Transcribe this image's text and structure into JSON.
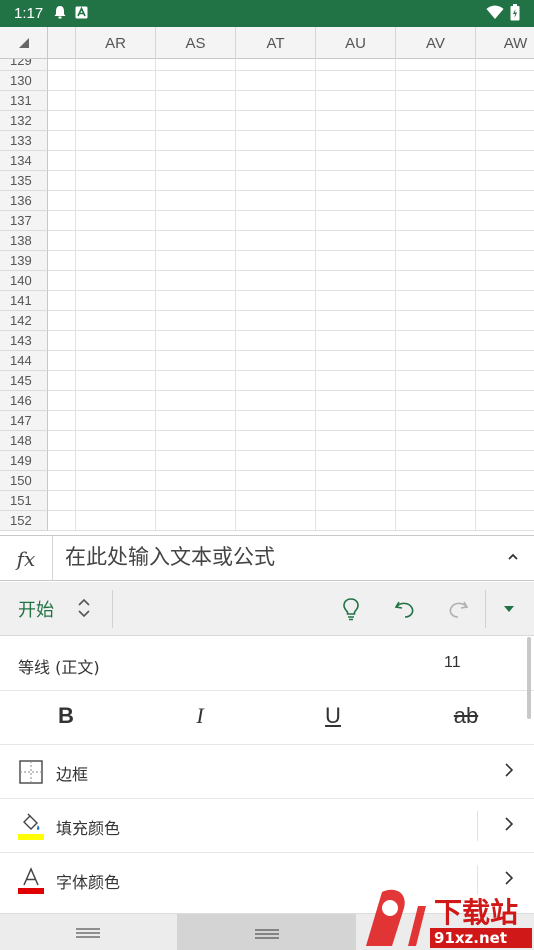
{
  "status_bar": {
    "time": "1:17"
  },
  "sheet": {
    "columns": [
      "AR",
      "AS",
      "AT",
      "AU",
      "AV",
      "AW"
    ],
    "rows": [
      "129",
      "130",
      "131",
      "132",
      "133",
      "134",
      "135",
      "136",
      "137",
      "138",
      "139",
      "140",
      "141",
      "142",
      "143",
      "144",
      "145",
      "146",
      "147",
      "148",
      "149",
      "150",
      "151",
      "152"
    ]
  },
  "formula_bar": {
    "fx_label": "fx",
    "placeholder": "在此处输入文本或公式"
  },
  "ribbon": {
    "tab": "开始"
  },
  "font": {
    "name": "等线 (正文)",
    "size": "11"
  },
  "format_buttons": {
    "bold": "B",
    "italic": "I",
    "underline": "U",
    "strike": "ab"
  },
  "options": [
    {
      "label": "边框"
    },
    {
      "label": "填充颜色"
    },
    {
      "label": "字体颜色"
    }
  ],
  "colors": {
    "brand": "#217346",
    "fill_swatch": "#ffff00",
    "font_swatch": "#e00000"
  },
  "watermark": {
    "text1": "下载站",
    "text2": "91xz.net"
  }
}
